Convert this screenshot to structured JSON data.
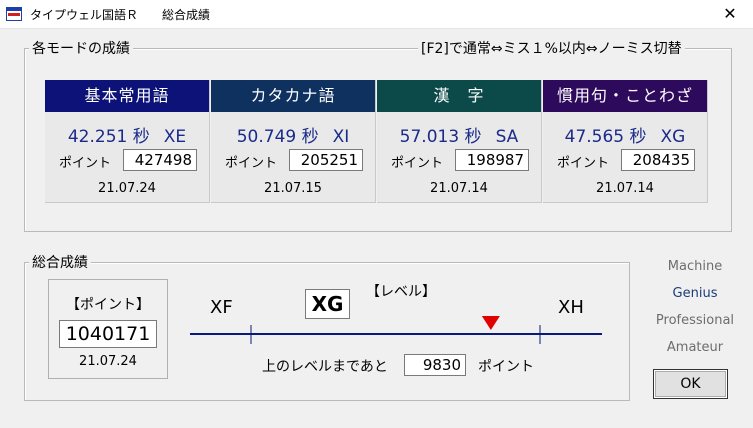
{
  "window": {
    "title": "タイプウェル国語Ｒ　　総合成績",
    "close_symbol": "✕",
    "icon": "app-window-icon"
  },
  "modes_group": {
    "label": "各モードの成績",
    "hint": "[F2]で通常⇔ミス１%以内⇔ノーミス切替",
    "point_label": "ポイント",
    "cards": [
      {
        "name": "基本常用語",
        "time": "42.251 秒",
        "level": "XE",
        "points": "427498",
        "date": "21.07.24",
        "color": "#0c1277"
      },
      {
        "name": "カタカナ語",
        "time": "50.749 秒",
        "level": "XI",
        "points": "205251",
        "date": "21.07.15",
        "color": "#0e3160"
      },
      {
        "name": "漢　字",
        "time": "57.013 秒",
        "level": "SA",
        "points": "198987",
        "date": "21.07.14",
        "color": "#0c4a4a"
      },
      {
        "name": "慣用句・ことわざ",
        "time": "47.565 秒",
        "level": "XG",
        "points": "208435",
        "date": "21.07.14",
        "color": "#2e0a5c"
      }
    ]
  },
  "total_group": {
    "label": "総合成績",
    "point_header": "【ポイント】",
    "total_points": "1040171",
    "total_date": "21.07.24",
    "level_header": "【レベル】",
    "current_level": "XG",
    "lower_level": "XF",
    "upper_level": "XH",
    "progress_fraction": 0.83,
    "remaining_prefix": "上のレベルまであと",
    "remaining_value": "9830",
    "remaining_suffix": "ポイント"
  },
  "level_list": [
    "Machine",
    "Genius",
    "Professional",
    "Amateur"
  ],
  "ok_label": "OK",
  "colors": {
    "marker": "#e00000",
    "scale_line": "#0a1a7a",
    "genius_text": "#1a3a7a",
    "muted_text": "#6d6d6d"
  }
}
